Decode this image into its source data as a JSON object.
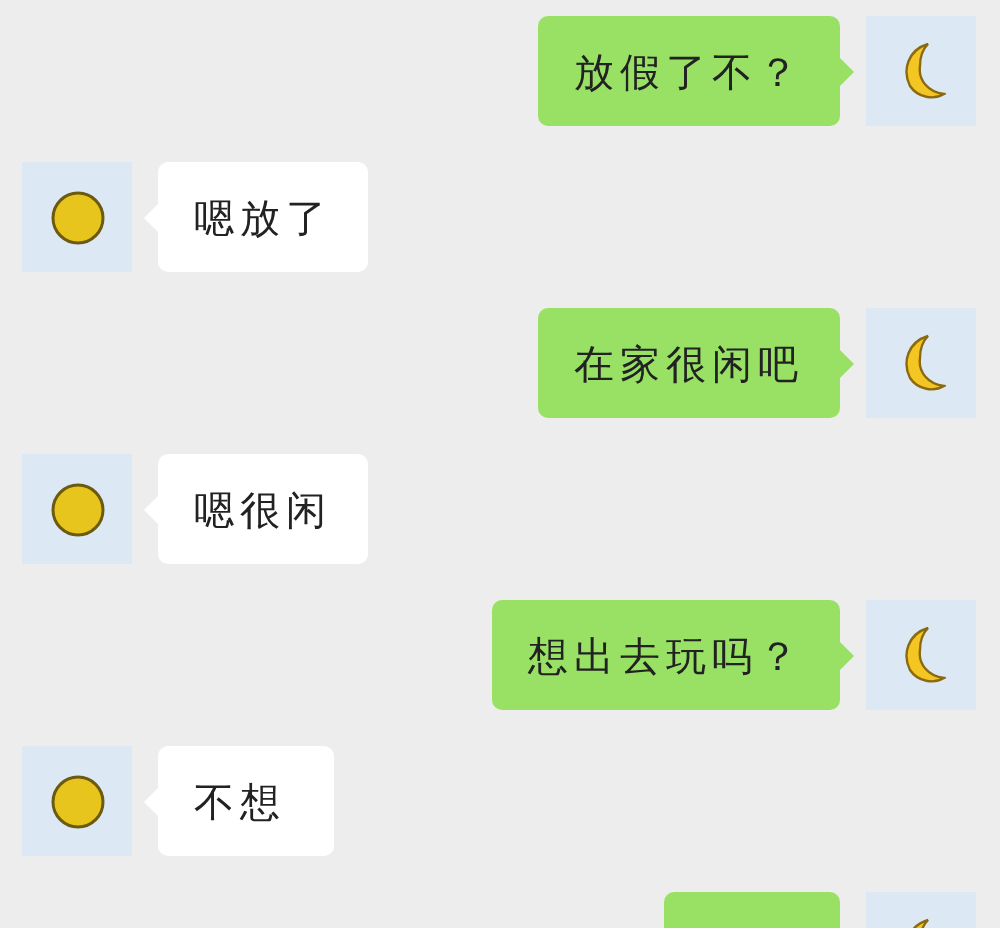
{
  "messages": [
    {
      "kind": "sent",
      "text": "放假了不？"
    },
    {
      "kind": "received",
      "text": "嗯放了"
    },
    {
      "kind": "sent",
      "text": "在家很闲吧"
    },
    {
      "kind": "received",
      "text": "嗯很闲"
    },
    {
      "kind": "sent",
      "text": "想出去玩吗？"
    },
    {
      "kind": "received",
      "text": "不想"
    },
    {
      "kind": "sent"
    }
  ]
}
